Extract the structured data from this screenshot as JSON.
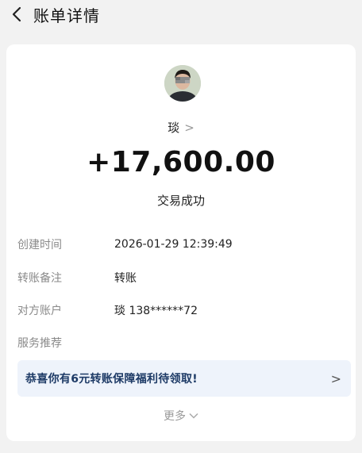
{
  "header": {
    "title": "账单详情",
    "back_icon": "chevron-left-icon"
  },
  "payer": {
    "name": "琰",
    "name_chevron": ">",
    "avatar_icon": "avatar-photo"
  },
  "transaction": {
    "amount": "+17,600.00",
    "status": "交易成功"
  },
  "details": [
    {
      "label": "创建时间",
      "value": "2026-01-29 12:39:49"
    },
    {
      "label": "转账备注",
      "value": "转账"
    },
    {
      "label": "对方账户",
      "value": "琰 138******72"
    },
    {
      "label": "服务推荐",
      "value": ""
    }
  ],
  "promo": {
    "text": "恭喜你有6元转账保障福利待领取!",
    "chevron": ">"
  },
  "more": {
    "label": "更多"
  }
}
